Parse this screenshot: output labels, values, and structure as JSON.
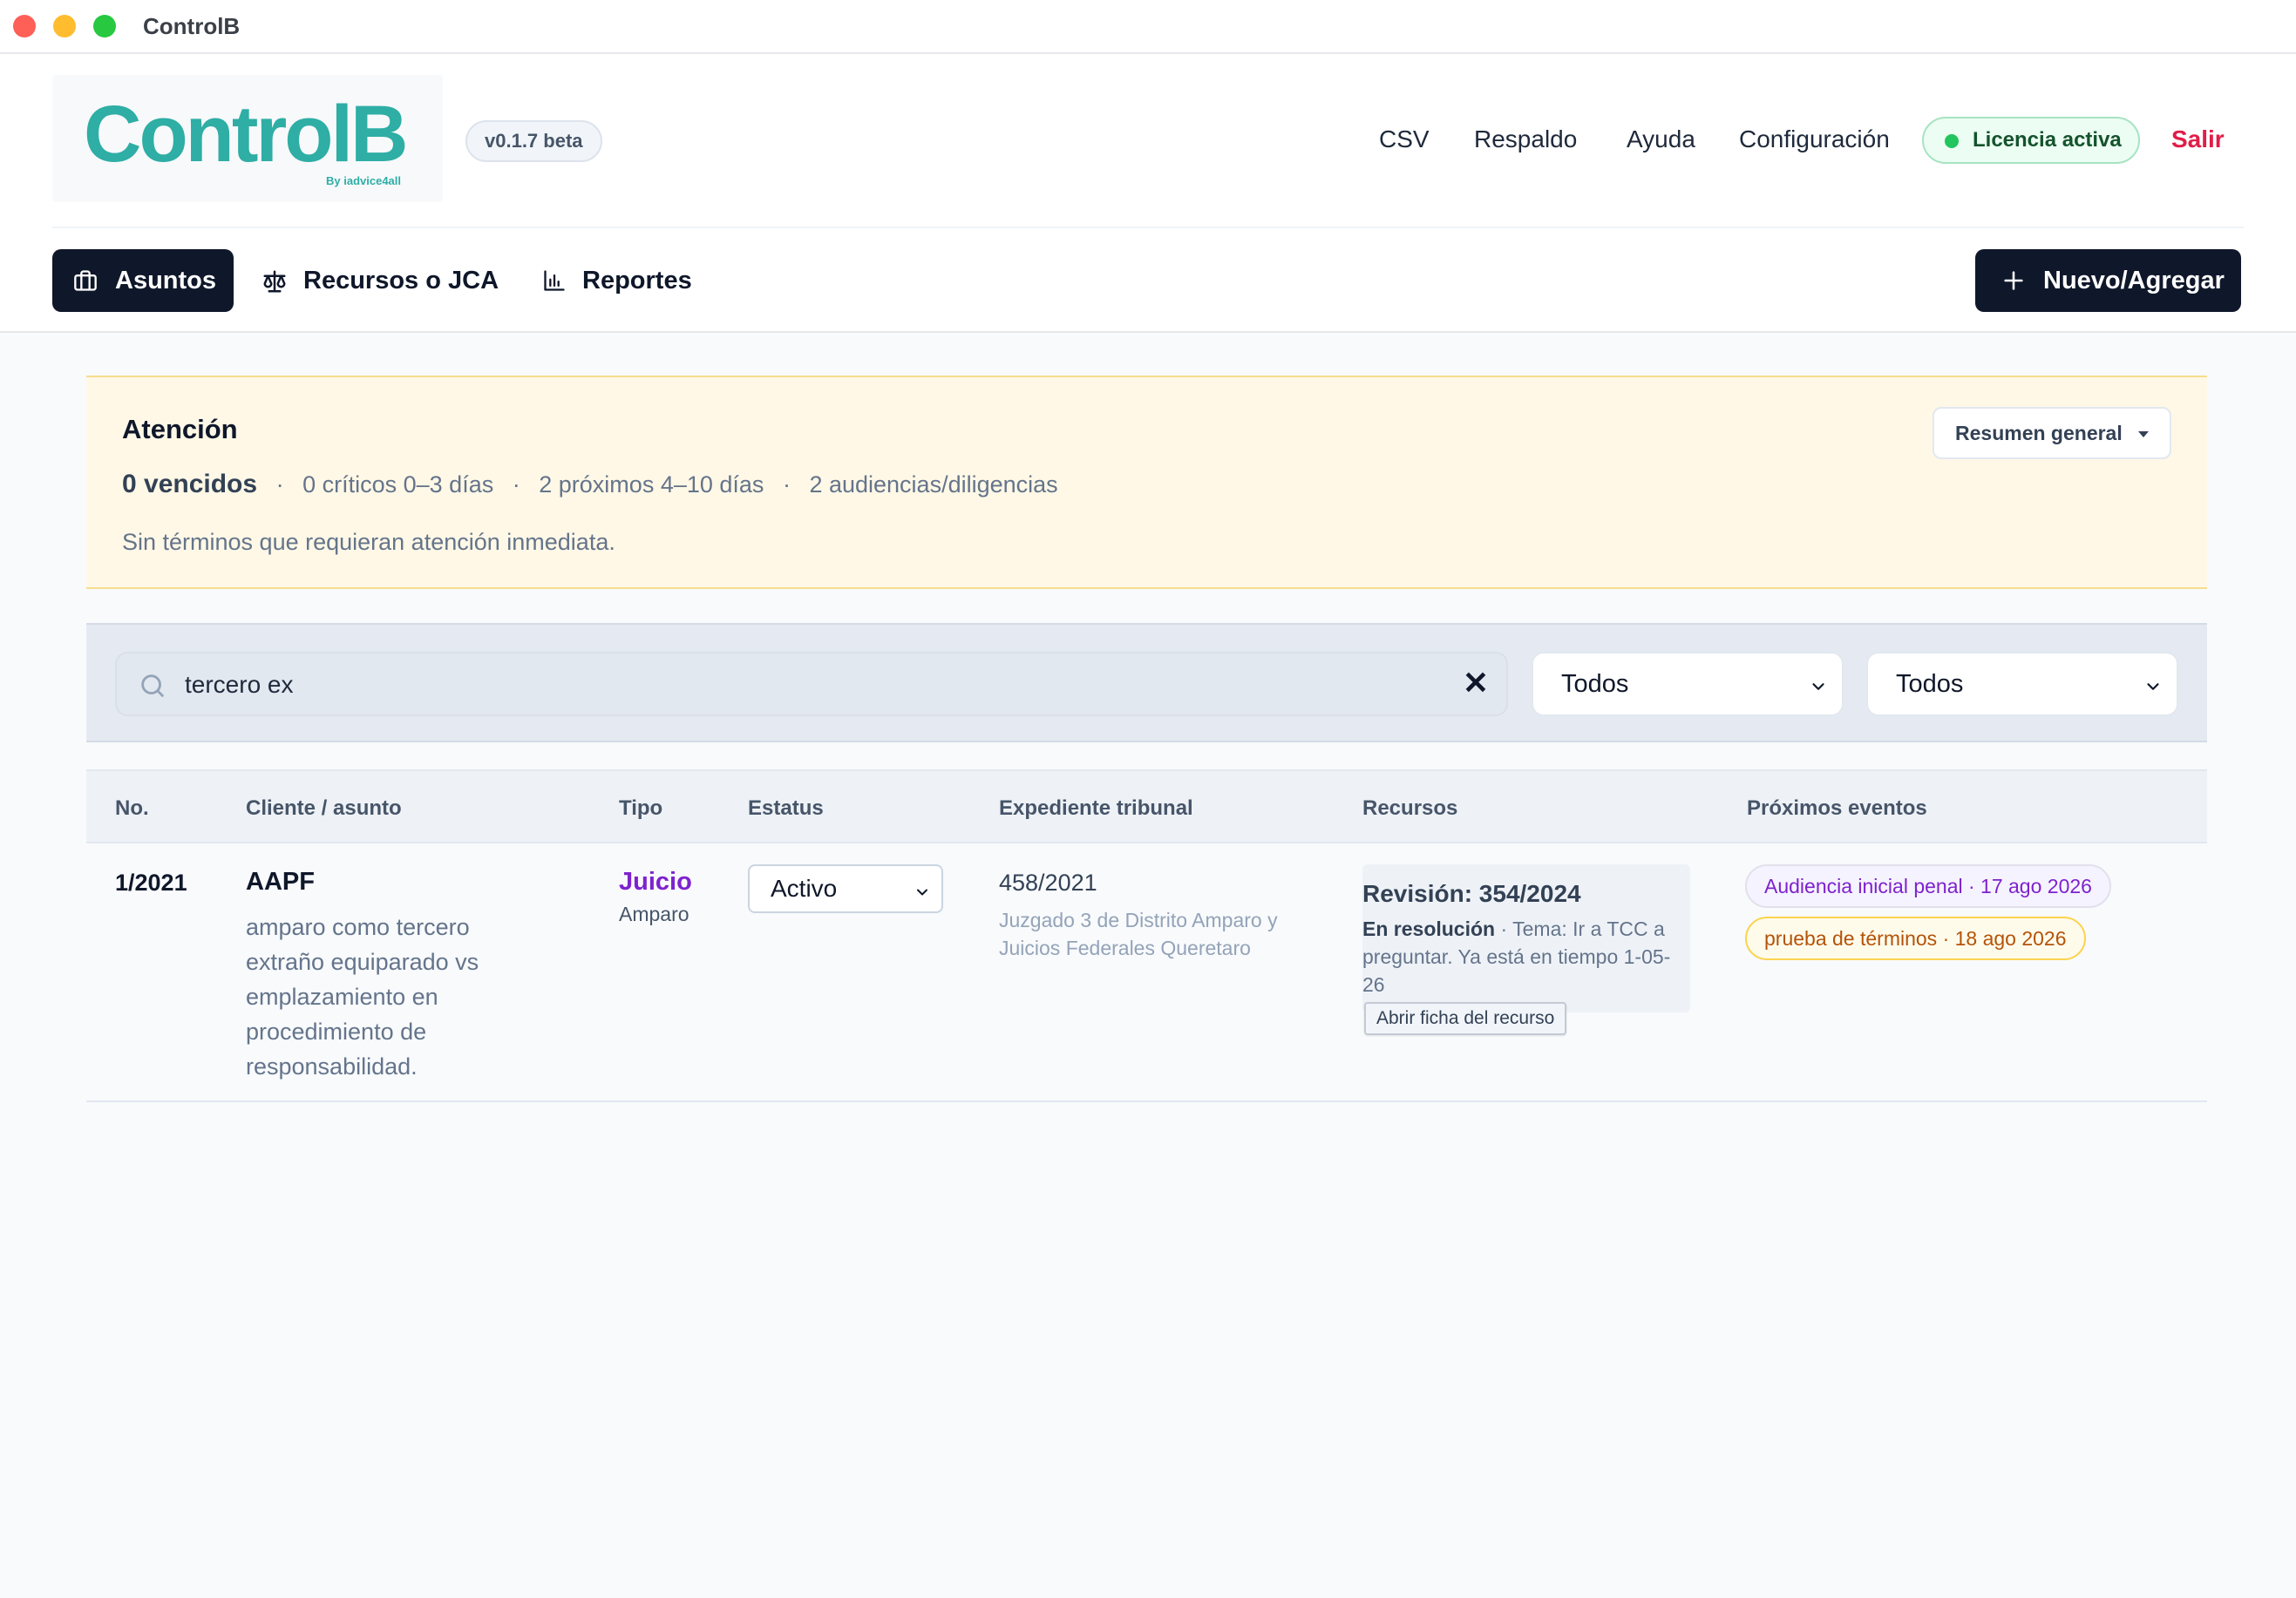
{
  "window": {
    "title": "ControlB"
  },
  "header": {
    "logo_text": "ControlB",
    "logo_sub": "By iadvice4all",
    "version": "v0.1.7 beta",
    "links": [
      "CSV",
      "Respaldo",
      "Ayuda",
      "Configuración"
    ],
    "license": "Licencia activa",
    "logout": "Salir"
  },
  "nav": {
    "tabs": [
      {
        "label": "Asuntos",
        "icon": "briefcase-icon",
        "active": true
      },
      {
        "label": "Recursos o JCA",
        "icon": "scale-icon",
        "active": false
      },
      {
        "label": "Reportes",
        "icon": "bar-chart-icon",
        "active": false
      }
    ],
    "new_button": "Nuevo/Agregar"
  },
  "attention": {
    "title": "Atención",
    "overdue": "0 vencidos",
    "critical": "0 críticos 0–3 días",
    "upcoming": "2 próximos 4–10 días",
    "hearings": "2 audiencias/diligencias",
    "message": "Sin términos que requieran atención inmediata.",
    "summary_button": "Resumen general",
    "separator": "·"
  },
  "filters": {
    "search_value": "tercero ex",
    "select1": "Todos",
    "select2": "Todos"
  },
  "table": {
    "headers": [
      "No.",
      "Cliente / asunto",
      "Tipo",
      "Estatus",
      "Expediente tribunal",
      "Recursos",
      "Próximos eventos"
    ],
    "rows": [
      {
        "no": "1/2021",
        "client": "AAPF",
        "description": "amparo como tercero extraño equiparado vs emplazamiento en procedimiento de responsabilidad.",
        "tipo": "Juicio",
        "tipo_sub": "Amparo",
        "status": "Activo",
        "expediente": "458/2021",
        "court": "Juzgado 3 de Distrito Amparo y Juicios Federales Queretaro",
        "recurso_title": "Revisión: 354/2024",
        "recurso_status": "En resolución",
        "recurso_note": "· Tema: Ir a TCC a preguntar. Ya está en tiempo 1-05-26",
        "recurso_button": "Abrir ficha del recurso",
        "events": [
          {
            "label": "Audiencia inicial penal · 17 ago 2026",
            "color": "#7e22ce"
          },
          {
            "label": "prueba de términos · 18 ago 2026",
            "color": "#b45309"
          }
        ]
      }
    ]
  },
  "colors": {
    "brand": "#2eaea5",
    "primary": "#0f172a",
    "danger": "#e11d48",
    "success": "#22c55e",
    "warning_bg": "#fff8e6"
  }
}
